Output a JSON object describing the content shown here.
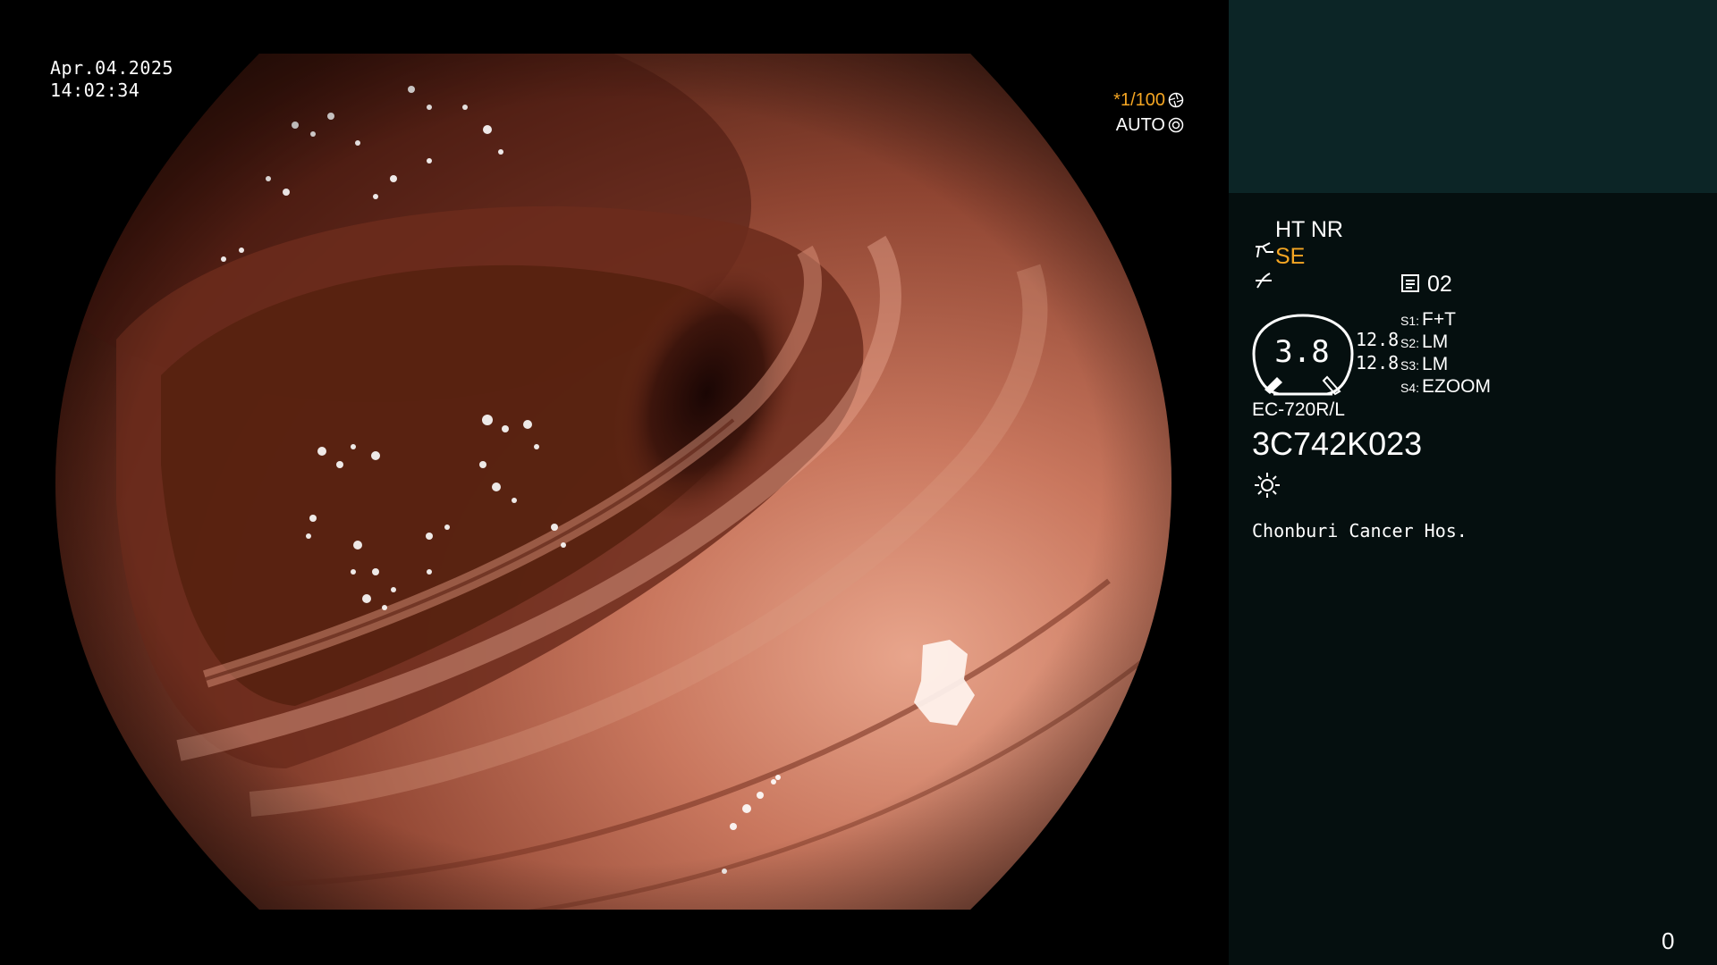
{
  "overlay": {
    "date": "Apr.04.2025",
    "time": "14:02:34",
    "shutter": "*1/100",
    "auto": "AUTO",
    "shutter_icon": "aperture-icon",
    "auto_icon": "iris-icon"
  },
  "status": {
    "modes": "HT NR",
    "se_icon": "forceps-icon",
    "se": "SE",
    "structure_icon": "structure-enhancement-icon",
    "record_icon": "memory-card-icon",
    "record": "02",
    "dial_value": "3.8",
    "value_1": "12.8",
    "value_2": "12.8",
    "switches": [
      {
        "key": "S1:",
        "value": "F+T"
      },
      {
        "key": "S2:",
        "value": "LM"
      },
      {
        "key": "S3:",
        "value": "LM"
      },
      {
        "key": "S4:",
        "value": "EZOOM"
      }
    ],
    "model": "EC-720R/L",
    "serial": "3C742K023",
    "light_icon": "sun-icon",
    "hospital": "Chonburi Cancer Hos.",
    "counter": "0"
  },
  "colors": {
    "accent": "#f5a623",
    "panel_top": "#0c2526",
    "panel_main": "#050f0f",
    "tissue": "#b0634c",
    "lumen": "#2d0f09"
  }
}
